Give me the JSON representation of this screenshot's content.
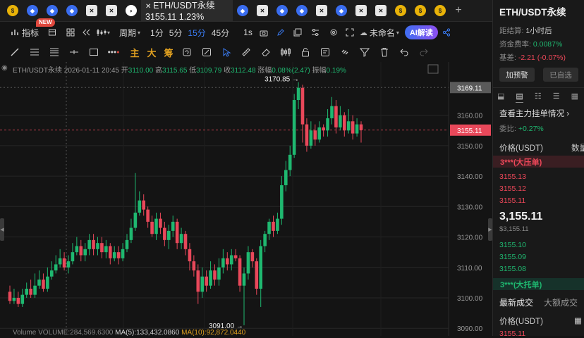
{
  "tabs": {
    "active_title": "ETH/USDT永续",
    "active_price": "3155.11",
    "active_change": "1.23%",
    "plus": "+"
  },
  "toolbar": {
    "indicators": "指标",
    "new_badge": "NEW",
    "period": "周期",
    "tf_1m": "1分",
    "tf_5m": "5分",
    "tf_15m": "15分",
    "tf_45m": "45分",
    "tf_1s": "1s",
    "layout_name": "未命名",
    "ai": "AI解读"
  },
  "draw_toolbar": {
    "main": "主",
    "big": "大",
    "chips": "筹"
  },
  "ohlc": {
    "symbol": "ETH/USDT永续",
    "datetime": "2026-01-11 20:45",
    "open_label": "开",
    "open": "3110.00",
    "high_label": "高",
    "high": "3115.65",
    "low_label": "低",
    "low": "3109.79",
    "close_label": "收",
    "close": "3112.48",
    "change_label": "涨幅",
    "change": "0.08%(2.47)",
    "amp_label": "振幅",
    "amp": "0.19%"
  },
  "volume": {
    "label": "Volume",
    "vol": "VOLUME:284,569.6300",
    "ma5": "MA(5):133,432.0860",
    "ma10": "MA(10):92,872.0440"
  },
  "sidebar": {
    "title": "ETH/USDT永续",
    "settle_label": "距结算:",
    "settle_value": "1小时后",
    "funding_label": "资金费率:",
    "funding_value": "0.0087%",
    "basis_label": "基差:",
    "basis_value": "-2.21 (-0.07%)",
    "alert_btn": "加预警",
    "fav_btn": "已自选",
    "orderbook_link": "查看主力挂单情况",
    "ratio_label": "委比:",
    "ratio_value": "+0.27%",
    "col_price": "价格(USDT)",
    "col_qty": "数量",
    "ask_big": "3***(大压单)",
    "asks": [
      "3155.13",
      "3155.12",
      "3155.11"
    ],
    "last_price": "3,155.11",
    "last_price_sub": "$3,155.11",
    "bids": [
      "3155.10",
      "3155.09",
      "3155.08"
    ],
    "bid_big": "3***(大托单)",
    "trades_tab1": "最新成交",
    "trades_tab2": "大额成交",
    "trades_col": "价格(USDT)",
    "trades_first": "3155.11"
  },
  "chart_data": {
    "type": "candlestick",
    "title": "ETH/USDT永续 15分",
    "y_ticks": [
      3090,
      3100,
      3110,
      3120,
      3130,
      3140,
      3150,
      3160
    ],
    "y_min": 3087.5,
    "y_max": 3177.5,
    "current_price": 3155.11,
    "highlight_price": 3169.11,
    "high_marker": "3170.85",
    "low_marker": "3091.00",
    "high_value": 3170.85,
    "low_value": 3091.0,
    "candles": [
      [
        3102,
        3099,
        3104,
        3098
      ],
      [
        3099,
        3100,
        3103,
        3098
      ],
      [
        3100,
        3098,
        3102,
        3097
      ],
      [
        3098,
        3101,
        3103,
        3097
      ],
      [
        3101,
        3103,
        3105,
        3100
      ],
      [
        3103,
        3101,
        3106,
        3100
      ],
      [
        3101,
        3104,
        3108,
        3100
      ],
      [
        3104,
        3106,
        3109,
        3103
      ],
      [
        3106,
        3103,
        3108,
        3102
      ],
      [
        3103,
        3107,
        3110,
        3102
      ],
      [
        3107,
        3109,
        3112,
        3106
      ],
      [
        3109,
        3111,
        3114,
        3108
      ],
      [
        3111,
        3113,
        3116,
        3110
      ],
      [
        3113,
        3110,
        3115,
        3109
      ],
      [
        3110,
        3112,
        3114,
        3108
      ],
      [
        3112,
        3115,
        3118,
        3111
      ],
      [
        3115,
        3117,
        3120,
        3114
      ],
      [
        3117,
        3114,
        3119,
        3112
      ],
      [
        3114,
        3116,
        3118,
        3112
      ],
      [
        3116,
        3119,
        3121,
        3114
      ],
      [
        3119,
        3116,
        3121,
        3114
      ],
      [
        3116,
        3118,
        3120,
        3114
      ],
      [
        3118,
        3115,
        3120,
        3113
      ],
      [
        3115,
        3117,
        3119,
        3113
      ],
      [
        3117,
        3113,
        3118,
        3111
      ],
      [
        3113,
        3115,
        3117,
        3112
      ],
      [
        3115,
        3113,
        3117,
        3111
      ],
      [
        3113,
        3116,
        3118,
        3112
      ],
      [
        3116,
        3119,
        3121,
        3115
      ],
      [
        3119,
        3123,
        3126,
        3118
      ],
      [
        3123,
        3128,
        3141,
        3122
      ],
      [
        3128,
        3132,
        3135,
        3127
      ],
      [
        3132,
        3129,
        3134,
        3127
      ],
      [
        3129,
        3125,
        3130,
        3123
      ],
      [
        3125,
        3121,
        3127,
        3120
      ],
      [
        3121,
        3126,
        3128,
        3119
      ],
      [
        3126,
        3123,
        3128,
        3121
      ],
      [
        3123,
        3119,
        3125,
        3117
      ],
      [
        3119,
        3122,
        3124,
        3116
      ],
      [
        3122,
        3125,
        3127,
        3120
      ],
      [
        3125,
        3118,
        3126,
        3116
      ],
      [
        3118,
        3121,
        3123,
        3116
      ],
      [
        3121,
        3116,
        3122,
        3114
      ],
      [
        3116,
        3112,
        3118,
        3109
      ],
      [
        3112,
        3109,
        3114,
        3107
      ],
      [
        3109,
        3102,
        3111,
        3098
      ],
      [
        3102,
        3107,
        3110,
        3100
      ],
      [
        3107,
        3104,
        3109,
        3102
      ],
      [
        3104,
        3109,
        3112,
        3103
      ],
      [
        3109,
        3106,
        3111,
        3104
      ],
      [
        3106,
        3110,
        3113,
        3104
      ],
      [
        3110,
        3113,
        3116,
        3108
      ],
      [
        3113,
        3111,
        3115,
        3109
      ],
      [
        3111,
        3114,
        3116,
        3109
      ],
      [
        3114,
        3113,
        3116,
        3112
      ],
      [
        3113,
        3104,
        3114,
        3102
      ],
      [
        3104,
        3108,
        3110,
        3091
      ],
      [
        3108,
        3115,
        3117,
        3106
      ],
      [
        3115,
        3112,
        3116,
        3110
      ],
      [
        3112,
        3103,
        3113,
        3101
      ],
      [
        3103,
        3117,
        3119,
        3097
      ],
      [
        3117,
        3121,
        3122,
        3115
      ],
      [
        3121,
        3125,
        3126,
        3119
      ],
      [
        3125,
        3122,
        3127,
        3120
      ],
      [
        3122,
        3126,
        3128,
        3121
      ],
      [
        3126,
        3137,
        3140,
        3124
      ],
      [
        3137,
        3142,
        3145,
        3135
      ],
      [
        3142,
        3147,
        3150,
        3140
      ],
      [
        3147,
        3165,
        3167,
        3146
      ],
      [
        3165,
        3169,
        3170.85,
        3162
      ],
      [
        3169,
        3157,
        3170,
        3151
      ],
      [
        3157,
        3150,
        3159,
        3148
      ],
      [
        3150,
        3155,
        3158,
        3149
      ],
      [
        3155,
        3152,
        3157,
        3150
      ],
      [
        3152,
        3156,
        3158,
        3151
      ],
      [
        3156,
        3155,
        3157,
        3153
      ],
      [
        3155,
        3159,
        3162,
        3153
      ],
      [
        3159,
        3163,
        3166,
        3157
      ],
      [
        3163,
        3156,
        3165,
        3154
      ],
      [
        3156,
        3160,
        3163,
        3155
      ],
      [
        3160,
        3155,
        3161,
        3153
      ],
      [
        3155,
        3158,
        3162,
        3154
      ],
      [
        3158,
        3154,
        3160,
        3152
      ],
      [
        3154,
        3157,
        3159,
        3153
      ],
      [
        3157,
        3155.11,
        3158,
        3151
      ]
    ],
    "up_color": "#1fb870",
    "down_color": "#e8485a"
  }
}
